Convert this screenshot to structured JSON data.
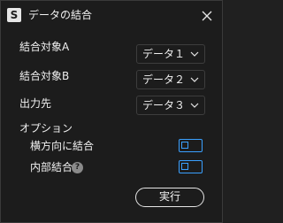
{
  "window": {
    "title": "データの結合",
    "app_icon_letter": "S"
  },
  "form": {
    "target_a": {
      "label": "結合対象A",
      "value": "データ１"
    },
    "target_b": {
      "label": "結合対象B",
      "value": "データ２"
    },
    "output": {
      "label": "出力先",
      "value": "データ３"
    }
  },
  "options": {
    "heading": "オプション",
    "horizontal": {
      "label": "横方向に結合",
      "checked": false
    },
    "inner": {
      "label": "内部結合",
      "checked": false,
      "help_icon": "?"
    }
  },
  "actions": {
    "run_label": "実行"
  },
  "colors": {
    "background": "#1c1c1c",
    "accent": "#3aa0ff"
  }
}
